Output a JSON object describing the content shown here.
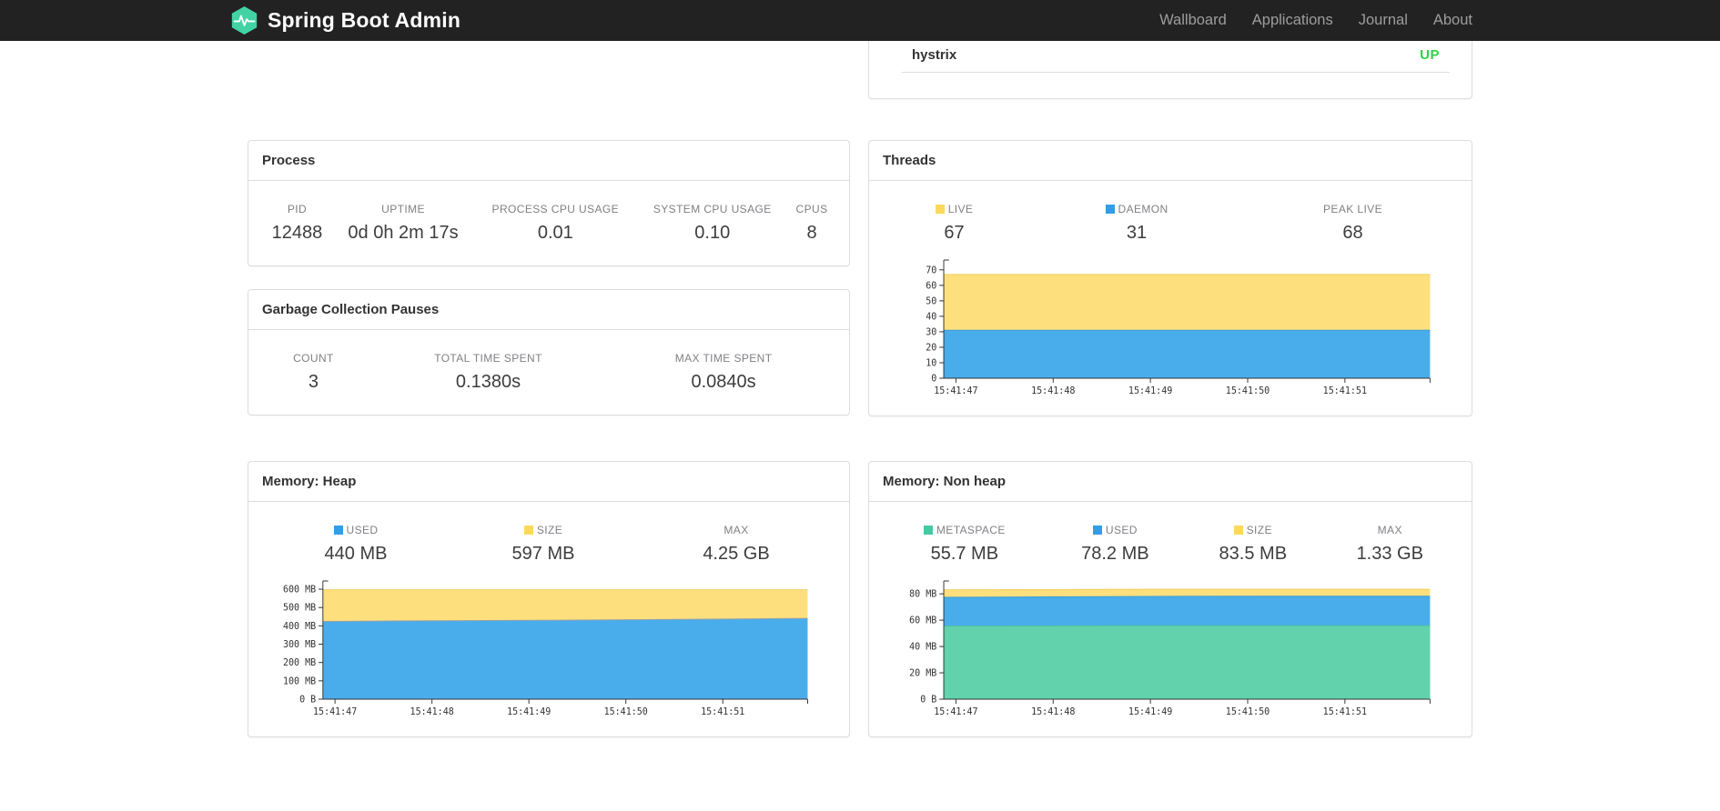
{
  "navbar": {
    "brand": "Spring Boot Admin",
    "items": [
      {
        "label": "Wallboard"
      },
      {
        "label": "Applications"
      },
      {
        "label": "Journal"
      },
      {
        "label": "About"
      }
    ]
  },
  "colors": {
    "navbar_bg": "#222222",
    "brand_green": "#42d3a4",
    "status_up_green": "#2fd148",
    "legend_yellow": "#fcd95c",
    "legend_blue": "#2f9fe8",
    "legend_green": "#45c9a2",
    "area_yellow": "#fde07d",
    "area_blue": "#49adec",
    "area_green": "#62d2ad",
    "card_border": "#dddddd"
  },
  "health_card": {
    "name": "hystrix",
    "status": "UP"
  },
  "process": {
    "title": "Process",
    "stats": [
      {
        "label": "PID",
        "value": "12488"
      },
      {
        "label": "UPTIME",
        "value": "0d 0h 2m 17s"
      },
      {
        "label": "PROCESS CPU USAGE",
        "value": "0.01"
      },
      {
        "label": "SYSTEM CPU USAGE",
        "value": "0.10"
      },
      {
        "label": "CPUS",
        "value": "8"
      }
    ]
  },
  "gc": {
    "title": "Garbage Collection Pauses",
    "stats": [
      {
        "label": "COUNT",
        "value": "3"
      },
      {
        "label": "TOTAL TIME SPENT",
        "value": "0.1380s"
      },
      {
        "label": "MAX TIME SPENT",
        "value": "0.0840s"
      }
    ]
  },
  "threads": {
    "title": "Threads",
    "stats": [
      {
        "label": "LIVE",
        "value": "67",
        "legend": "#fcd95c"
      },
      {
        "label": "DAEMON",
        "value": "31",
        "legend": "#2f9fe8"
      },
      {
        "label": "PEAK LIVE",
        "value": "68"
      }
    ]
  },
  "heap": {
    "title": "Memory: Heap",
    "stats": [
      {
        "label": "USED",
        "value": "440 MB",
        "legend": "#2f9fe8"
      },
      {
        "label": "SIZE",
        "value": "597 MB",
        "legend": "#fcd95c"
      },
      {
        "label": "MAX",
        "value": "4.25 GB"
      }
    ]
  },
  "nonheap": {
    "title": "Memory: Non heap",
    "stats": [
      {
        "label": "METASPACE",
        "value": "55.7 MB",
        "legend": "#45c9a2"
      },
      {
        "label": "USED",
        "value": "78.2 MB",
        "legend": "#2f9fe8"
      },
      {
        "label": "SIZE",
        "value": "83.5 MB",
        "legend": "#fcd95c"
      },
      {
        "label": "MAX",
        "value": "1.33 GB"
      }
    ]
  },
  "chart_data": [
    {
      "id": "threads",
      "type": "area",
      "title": "Threads",
      "xlabel": "",
      "ylabel": "",
      "grid": false,
      "legend_position": "stats-row-above",
      "x_ticks": [
        "15:41:47",
        "15:41:48",
        "15:41:49",
        "15:41:50",
        "15:41:51"
      ],
      "y_ticks": [
        {
          "v": 0,
          "label": "0"
        },
        {
          "v": 10,
          "label": "10"
        },
        {
          "v": 20,
          "label": "20"
        },
        {
          "v": 30,
          "label": "30"
        },
        {
          "v": 40,
          "label": "40"
        },
        {
          "v": 50,
          "label": "50"
        },
        {
          "v": 60,
          "label": "60"
        },
        {
          "v": 70,
          "label": "70"
        }
      ],
      "y_max": 74,
      "series": [
        {
          "name": "LIVE",
          "fill": "#fde07d",
          "line": "#f3cd5d",
          "values": [
            67,
            67,
            67,
            67,
            67,
            67,
            67
          ]
        },
        {
          "name": "DAEMON",
          "fill": "#49adec",
          "line": "#3b9bd6",
          "values": [
            31,
            31,
            31,
            31,
            31,
            31,
            31
          ]
        }
      ]
    },
    {
      "id": "heap",
      "type": "area",
      "title": "Memory: Heap",
      "xlabel": "",
      "ylabel": "",
      "grid": false,
      "legend_position": "stats-row-above",
      "x_ticks": [
        "15:41:47",
        "15:41:48",
        "15:41:49",
        "15:41:50",
        "15:41:51"
      ],
      "y_ticks": [
        {
          "v": 0,
          "label": "0 B"
        },
        {
          "v": 100,
          "label": "100 MB"
        },
        {
          "v": 200,
          "label": "200 MB"
        },
        {
          "v": 300,
          "label": "300 MB"
        },
        {
          "v": 400,
          "label": "400 MB"
        },
        {
          "v": 500,
          "label": "500 MB"
        },
        {
          "v": 600,
          "label": "600 MB"
        }
      ],
      "y_max": 625,
      "series": [
        {
          "name": "SIZE",
          "fill": "#fde07d",
          "line": "#f3cd5d",
          "values": [
            597,
            597,
            597,
            597,
            597,
            597,
            597
          ]
        },
        {
          "name": "USED",
          "fill": "#49adec",
          "line": "#9aa0a6",
          "values": [
            424,
            427,
            429,
            431,
            434,
            437,
            441
          ]
        }
      ]
    },
    {
      "id": "nonheap",
      "type": "area",
      "title": "Memory: Non heap",
      "xlabel": "",
      "ylabel": "",
      "grid": false,
      "legend_position": "stats-row-above",
      "x_ticks": [
        "15:41:47",
        "15:41:48",
        "15:41:49",
        "15:41:50",
        "15:41:51"
      ],
      "y_ticks": [
        {
          "v": 0,
          "label": "0 B"
        },
        {
          "v": 20,
          "label": "20 MB"
        },
        {
          "v": 40,
          "label": "40 MB"
        },
        {
          "v": 60,
          "label": "60 MB"
        },
        {
          "v": 80,
          "label": "80 MB"
        }
      ],
      "y_max": 87,
      "series": [
        {
          "name": "SIZE",
          "fill": "#fde07d",
          "line": "#f3cd5d",
          "values": [
            83.0,
            83.2,
            83.4,
            83.5,
            83.5,
            83.5,
            83.5
          ]
        },
        {
          "name": "USED",
          "fill": "#49adec",
          "line": "#3b9bd6",
          "values": [
            77.3,
            77.6,
            77.9,
            78.1,
            78.2,
            78.2,
            78.2
          ]
        },
        {
          "name": "METASPACE",
          "fill": "#62d2ad",
          "line": "#4fc49c",
          "values": [
            55.5,
            55.6,
            55.7,
            55.7,
            55.7,
            55.7,
            55.7
          ]
        }
      ]
    }
  ]
}
